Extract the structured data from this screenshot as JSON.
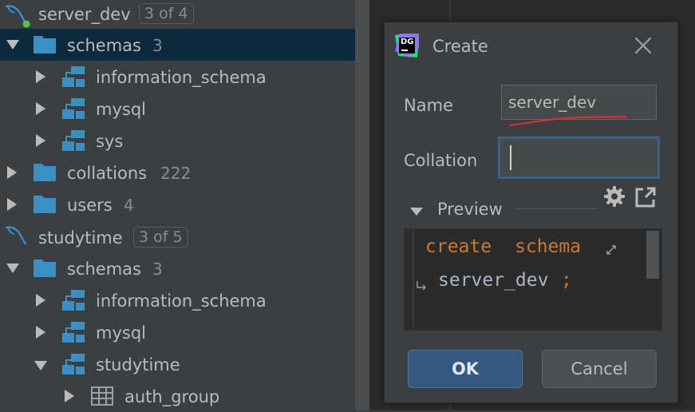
{
  "tree": {
    "rows": [
      {
        "label": "server_dev",
        "badge": "3 of 4"
      },
      {
        "label": "schemas",
        "count": "3"
      },
      {
        "label": "information_schema"
      },
      {
        "label": "mysql"
      },
      {
        "label": "sys"
      },
      {
        "label": "collations",
        "count": "222"
      },
      {
        "label": "users",
        "count": "4"
      },
      {
        "label": "studytime",
        "badge": "3 of 5"
      },
      {
        "label": "schemas",
        "count": "3"
      },
      {
        "label": "information_schema"
      },
      {
        "label": "mysql"
      },
      {
        "label": "studytime"
      },
      {
        "label": "auth_group"
      }
    ]
  },
  "dialog": {
    "logo_text": "DG",
    "title": "Create",
    "name_label": "Name",
    "name_value": "server_dev",
    "collation_label": "Collation",
    "collation_value": "",
    "preview_label": "Preview",
    "code": {
      "keyword_create": "create",
      "keyword_schema": "schema",
      "identifier": "server_dev",
      "terminator": ";"
    },
    "ok_label": "OK",
    "cancel_label": "Cancel"
  },
  "colors": {
    "selection": "#0d293e",
    "folder": "#3b8fc4",
    "keyword": "#cc7832",
    "ok_button": "#365880",
    "error_underline": "#e03030",
    "connection_green": "#5cc04a"
  },
  "icons": {
    "datasource": "mysql-dolphin-icon",
    "folder": "folder-icon",
    "schema": "schema-icon",
    "table": "table-icon",
    "settings": "gear-icon",
    "open_external": "open-in-new-window-icon",
    "close": "close-icon"
  }
}
